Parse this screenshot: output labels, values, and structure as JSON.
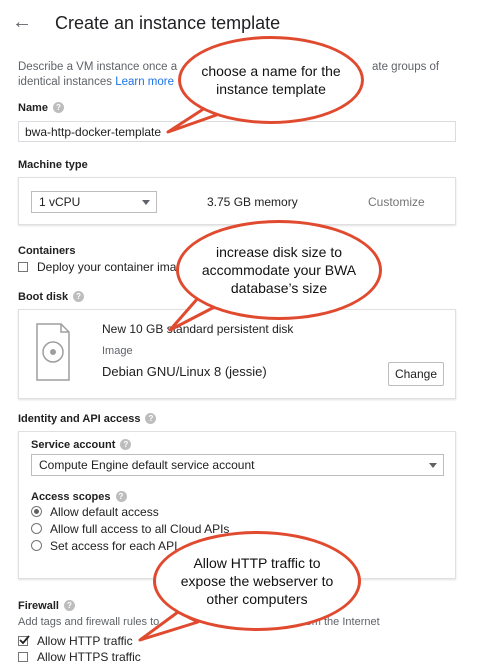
{
  "header": {
    "title": "Create an instance template",
    "back_icon": "arrow-left-icon"
  },
  "description": {
    "text": "Describe a VM instance once a",
    "tail": "ate groups of",
    "line2": "identical instances",
    "link": "Learn more"
  },
  "name": {
    "label": "Name",
    "value": "bwa-http-docker-template"
  },
  "machine_type": {
    "label": "Machine type",
    "cpu": "1 vCPU",
    "memory": "3.75 GB memory",
    "customize": "Customize"
  },
  "containers": {
    "label": "Containers",
    "checkbox_label": "Deploy your container imag"
  },
  "boot_disk": {
    "label": "Boot disk",
    "title": "New 10 GB standard persistent disk",
    "image_label": "Image",
    "image": "Debian GNU/Linux 8 (jessie)",
    "change": "Change"
  },
  "identity": {
    "label": "Identity and API access",
    "service_account_label": "Service account",
    "service_account": "Compute Engine default service account",
    "access_scopes_label": "Access scopes",
    "scopes": [
      "Allow default access",
      "Allow full access to all Cloud APIs",
      "Set access for each API"
    ]
  },
  "firewall": {
    "label": "Firewall",
    "desc_left": "Add tags and firewall rules to",
    "desc_right": "rom the Internet",
    "options": [
      "Allow HTTP traffic",
      "Allow HTTPS traffic"
    ]
  },
  "callouts": {
    "name": "choose a name for the instance template",
    "disk": "increase disk size to accommodate your BWA database’s size",
    "http": "Allow HTTP traffic to expose the webserver to other computers"
  },
  "colors": {
    "callout_border": "#e04a2f",
    "link": "#1a73e8"
  }
}
